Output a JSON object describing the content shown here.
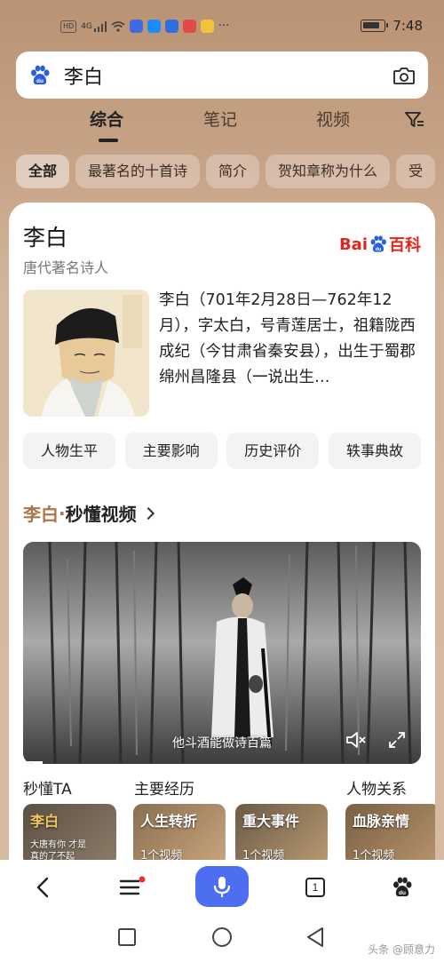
{
  "status_bar": {
    "network": "HD",
    "signal": "4G",
    "time": "7:48",
    "more": "···",
    "battery_level": 0.85
  },
  "search": {
    "query": "李白"
  },
  "tabs": [
    {
      "label": "综合",
      "active": true
    },
    {
      "label": "笔记",
      "active": false
    },
    {
      "label": "视频",
      "active": false
    }
  ],
  "chips": [
    {
      "label": "全部",
      "active": true
    },
    {
      "label": "最著名的十首诗",
      "active": false
    },
    {
      "label": "简介",
      "active": false
    },
    {
      "label": "贺知章称为什么",
      "active": false
    },
    {
      "label": "受",
      "active": false
    }
  ],
  "card": {
    "title": "李白",
    "subtitle": "唐代著名诗人",
    "logo": {
      "bai": "Bai",
      "du": "du",
      "baike": "百科"
    },
    "intro": "李白（701年2月28日—762年12月），字太白，号青莲居士，祖籍陇西成纪（今甘肃省秦安县），出生于蜀郡绵州昌隆县（一说出生…",
    "sections": [
      "人物生平",
      "主要影响",
      "历史评价",
      "轶事典故"
    ]
  },
  "video_section": {
    "name": "李白",
    "dot": "·",
    "title": "秒懂视频",
    "caption": "他斗酒能做诗百篇",
    "progress": 0.05
  },
  "related": {
    "headings": [
      "秒懂TA",
      "主要经历",
      "人物关系"
    ],
    "thumbs": [
      {
        "title": "李白",
        "sub": "大唐有你 才是真的了不起"
      },
      {
        "title": "人生转折",
        "sub": "1个视频"
      },
      {
        "title": "重大事件",
        "sub": "1个视频"
      },
      {
        "title": "血脉亲情",
        "sub": "1个视频"
      }
    ]
  },
  "bottom_nav": {
    "tab_count": "1"
  },
  "watermark": "头条 @顾意力",
  "colors": {
    "accent_blue": "#4e6ef2",
    "baike_red": "#e1251b",
    "name_brown": "#a8764a"
  },
  "icons": [
    "baidu-paw-icon",
    "camera-icon",
    "filter-icon",
    "back-icon",
    "menu-icon",
    "mic-icon",
    "tabs-icon",
    "mute-icon",
    "fullscreen-icon"
  ]
}
